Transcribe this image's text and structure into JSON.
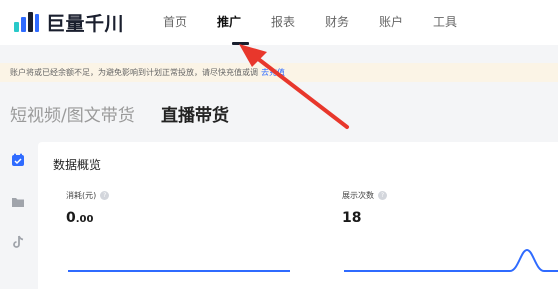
{
  "app": {
    "brand_name": "巨量千川",
    "brand_colors": {
      "dark": "#1a1f2e",
      "teal": "#29c9c9",
      "blue": "#2f6bff"
    }
  },
  "nav": {
    "items": [
      {
        "label": "首页",
        "active": false
      },
      {
        "label": "推广",
        "active": true
      },
      {
        "label": "报表",
        "active": false
      },
      {
        "label": "财务",
        "active": false
      },
      {
        "label": "账户",
        "active": false
      },
      {
        "label": "工具",
        "active": false
      }
    ]
  },
  "notice": {
    "text": "账户将或已经余额不足，为避免影响到计划正常投放，请尽快充值或调",
    "link": "去充值"
  },
  "tabs": [
    {
      "label": "短视频/图文带货",
      "active": false
    },
    {
      "label": "直播带货",
      "active": true
    }
  ],
  "sidebar": {
    "icons": [
      "calendar-check-icon",
      "folder-icon",
      "tiktok-icon"
    ]
  },
  "overview": {
    "title": "数据概览",
    "metrics": [
      {
        "label": "消耗(元)",
        "value_int": "0",
        "value_dec": ".00"
      },
      {
        "label": "展示次数",
        "value": "18"
      }
    ]
  },
  "annotation": {
    "type": "red-arrow",
    "color": "#e8372c"
  }
}
